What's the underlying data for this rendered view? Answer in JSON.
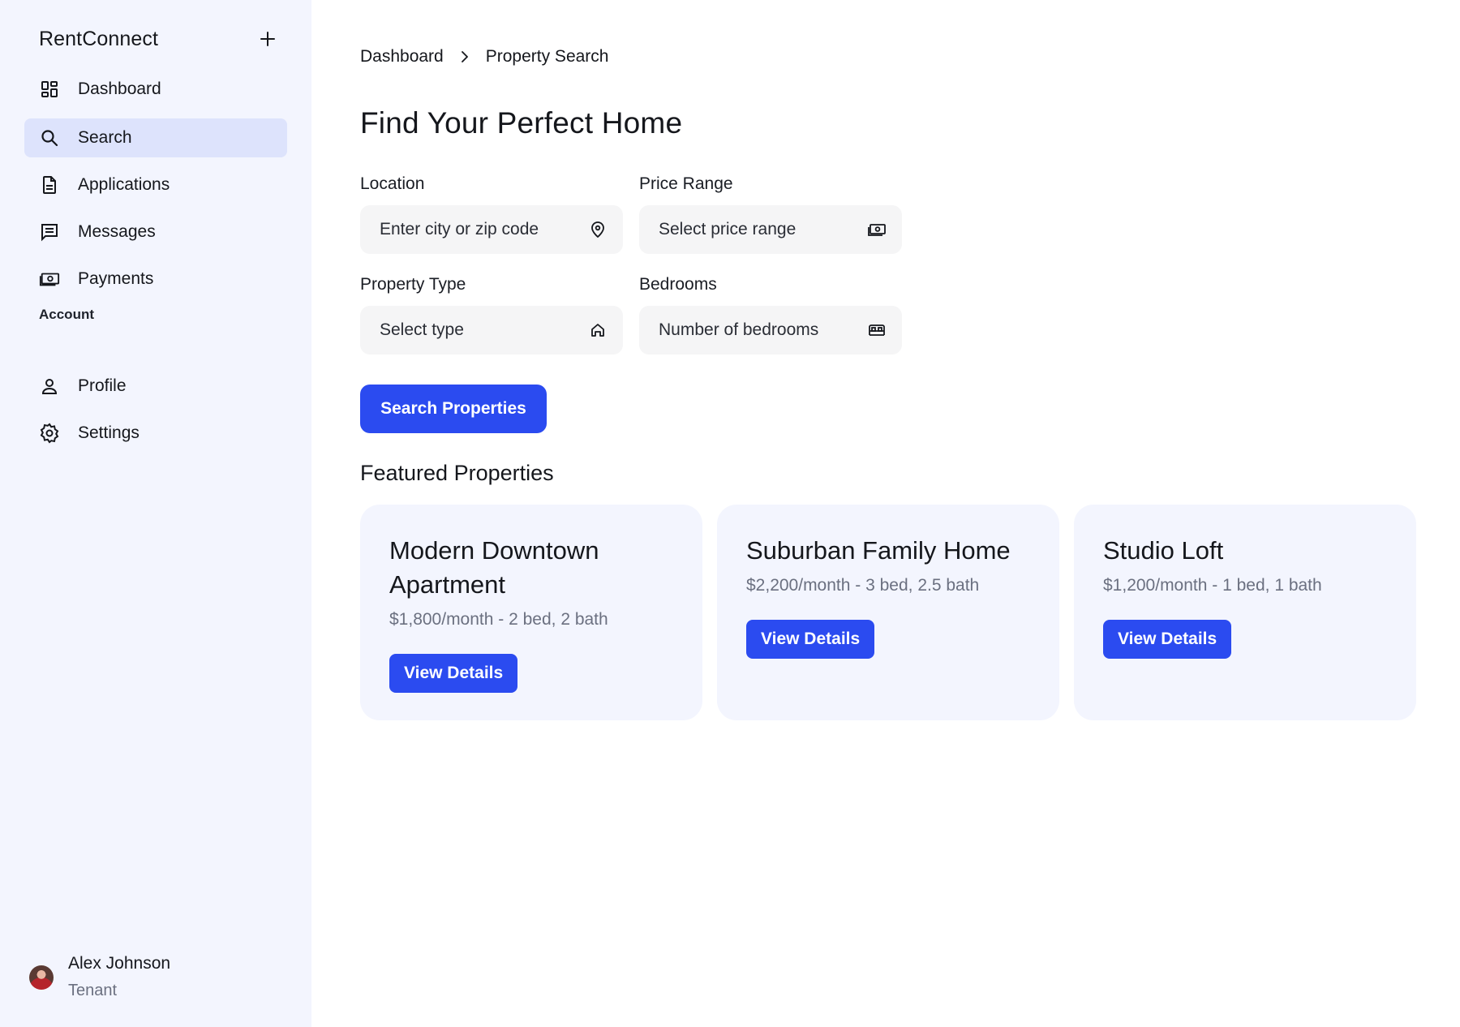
{
  "app": {
    "title": "RentConnect"
  },
  "sidebar": {
    "items": [
      {
        "label": "Dashboard",
        "icon": "dashboard-icon"
      },
      {
        "label": "Search",
        "icon": "search-icon",
        "active": true
      },
      {
        "label": "Applications",
        "icon": "document-icon"
      },
      {
        "label": "Messages",
        "icon": "message-icon"
      },
      {
        "label": "Payments",
        "icon": "cash-icon"
      }
    ],
    "account_label": "Account",
    "account_items": [
      {
        "label": "Profile",
        "icon": "person-icon"
      },
      {
        "label": "Settings",
        "icon": "gear-icon"
      }
    ],
    "user": {
      "name": "Alex Johnson",
      "role": "Tenant"
    }
  },
  "breadcrumb": [
    "Dashboard",
    "Property Search"
  ],
  "page": {
    "title": "Find Your Perfect Home"
  },
  "form": {
    "location": {
      "label": "Location",
      "placeholder": "Enter city or zip code",
      "icon": "map-pin-icon"
    },
    "price": {
      "label": "Price Range",
      "placeholder": "Select price range",
      "icon": "cash-icon"
    },
    "type": {
      "label": "Property Type",
      "placeholder": "Select type",
      "icon": "home-icon"
    },
    "bedrooms": {
      "label": "Bedrooms",
      "placeholder": "Number of bedrooms",
      "icon": "bed-icon"
    },
    "submit_label": "Search Properties"
  },
  "featured": {
    "title": "Featured Properties",
    "cards": [
      {
        "title": "Modern Downtown Apartment",
        "meta": "$1,800/month - 2 bed, 2 bath",
        "button": "View Details"
      },
      {
        "title": "Suburban Family Home",
        "meta": "$2,200/month - 3 bed, 2.5 bath",
        "button": "View Details"
      },
      {
        "title": "Studio Loft",
        "meta": "$1,200/month - 1 bed, 1 bath",
        "button": "View Details"
      }
    ]
  },
  "colors": {
    "accent": "#2b4bf0",
    "sidebar_bg": "#f3f5fe",
    "active_bg": "#dde3fc"
  }
}
